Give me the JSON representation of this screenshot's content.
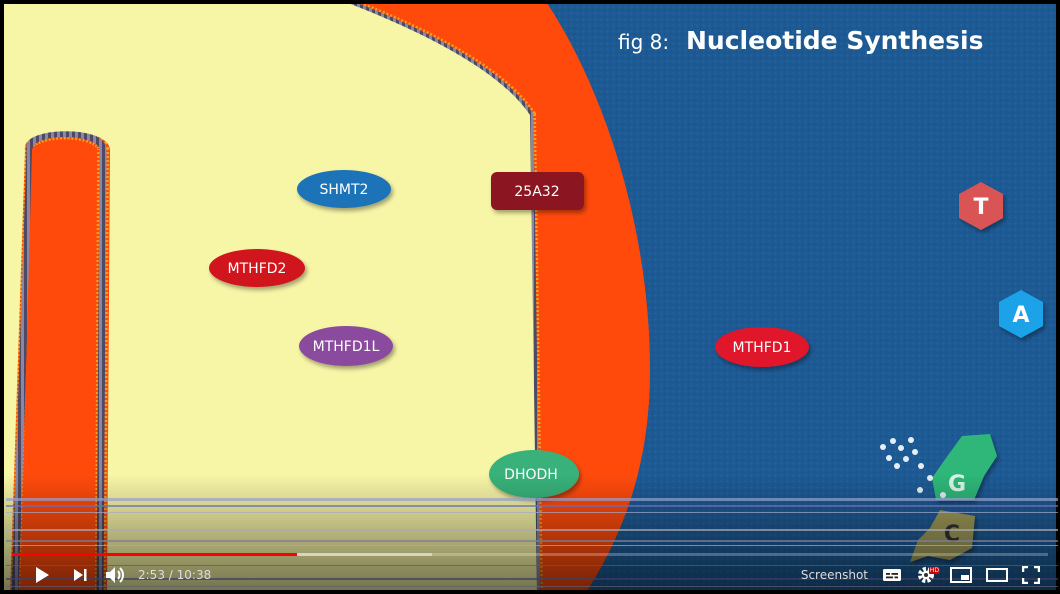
{
  "video": {
    "fig_label": "fig 8:",
    "title": "Nucleotide Synthesis",
    "enzymes": {
      "shmt2": "SHMT2",
      "x25a32": "25A32",
      "mthfd2": "MTHFD2",
      "mthfd1l": "MTHFD1L",
      "dhodh": "DHODH",
      "mthfd1": "MTHFD1"
    },
    "nucleotides": {
      "t": "T",
      "a": "A",
      "g": "G",
      "c": "C"
    },
    "colors": {
      "cytoplasm_blue": "#1d5a94",
      "mito_outer": "#ff4a0c",
      "mito_matrix": "#f7f5a6",
      "shmt2": "#1a73b8",
      "x25a32": "#8b1420",
      "mthfd2": "#d0121f",
      "mthfd1l": "#8a4c9e",
      "dhodh": "#39b27a",
      "mthfd1": "#e0122a",
      "nuc_t": "#d95555",
      "nuc_a": "#1aa2e8",
      "nuc_g": "#2fb779",
      "nuc_c": "#9e9a58"
    }
  },
  "player": {
    "progress": {
      "played_fraction": 0.275,
      "loaded_fraction": 0.405
    },
    "current_time": "2:53",
    "separator": " / ",
    "duration": "10:38",
    "screenshot_label": "Screenshot",
    "hd_badge": "HD",
    "icons": {
      "play": "play-icon",
      "next": "next-icon",
      "volume": "volume-icon",
      "subtitles": "subtitles-icon",
      "settings": "gear-icon",
      "miniplayer": "miniplayer-icon",
      "theater": "theater-icon",
      "fullscreen": "fullscreen-icon"
    },
    "colors": {
      "played": "#ff0000"
    }
  }
}
